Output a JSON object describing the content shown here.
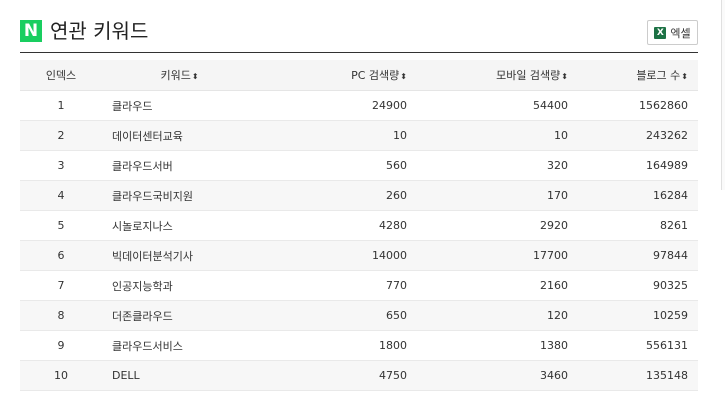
{
  "header": {
    "logo_letter": "N",
    "title": "연관 키워드",
    "excel_label": "엑셀",
    "excel_icon_letter": "X"
  },
  "table": {
    "columns": [
      {
        "label": "인덱스",
        "sortable": false
      },
      {
        "label": "키워드",
        "sortable": true
      },
      {
        "label": "PC 검색량",
        "sortable": true
      },
      {
        "label": "모바일 검색량",
        "sortable": true
      },
      {
        "label": "블로그 수",
        "sortable": true
      }
    ],
    "sort_icon": "⬍",
    "rows": [
      {
        "index": "1",
        "keyword": "클라우드",
        "pc": "24900",
        "mobile": "54400",
        "blog": "1562860"
      },
      {
        "index": "2",
        "keyword": "데이터센터교육",
        "pc": "10",
        "mobile": "10",
        "blog": "243262"
      },
      {
        "index": "3",
        "keyword": "클라우드서버",
        "pc": "560",
        "mobile": "320",
        "blog": "164989"
      },
      {
        "index": "4",
        "keyword": "클라우드국비지원",
        "pc": "260",
        "mobile": "170",
        "blog": "16284"
      },
      {
        "index": "5",
        "keyword": "시놀로지나스",
        "pc": "4280",
        "mobile": "2920",
        "blog": "8261"
      },
      {
        "index": "6",
        "keyword": "빅데이터분석기사",
        "pc": "14000",
        "mobile": "17700",
        "blog": "97844"
      },
      {
        "index": "7",
        "keyword": "인공지능학과",
        "pc": "770",
        "mobile": "2160",
        "blog": "90325"
      },
      {
        "index": "8",
        "keyword": "더존클라우드",
        "pc": "650",
        "mobile": "120",
        "blog": "10259"
      },
      {
        "index": "9",
        "keyword": "클라우드서비스",
        "pc": "1800",
        "mobile": "1380",
        "blog": "556131"
      },
      {
        "index": "10",
        "keyword": "DELL",
        "pc": "4750",
        "mobile": "3460",
        "blog": "135148"
      }
    ]
  },
  "colors": {
    "logo_green": "#19ce60",
    "excel_green": "#1d7245",
    "header_bg": "#f5f5f5",
    "stripe_bg": "#f7f7f7"
  }
}
